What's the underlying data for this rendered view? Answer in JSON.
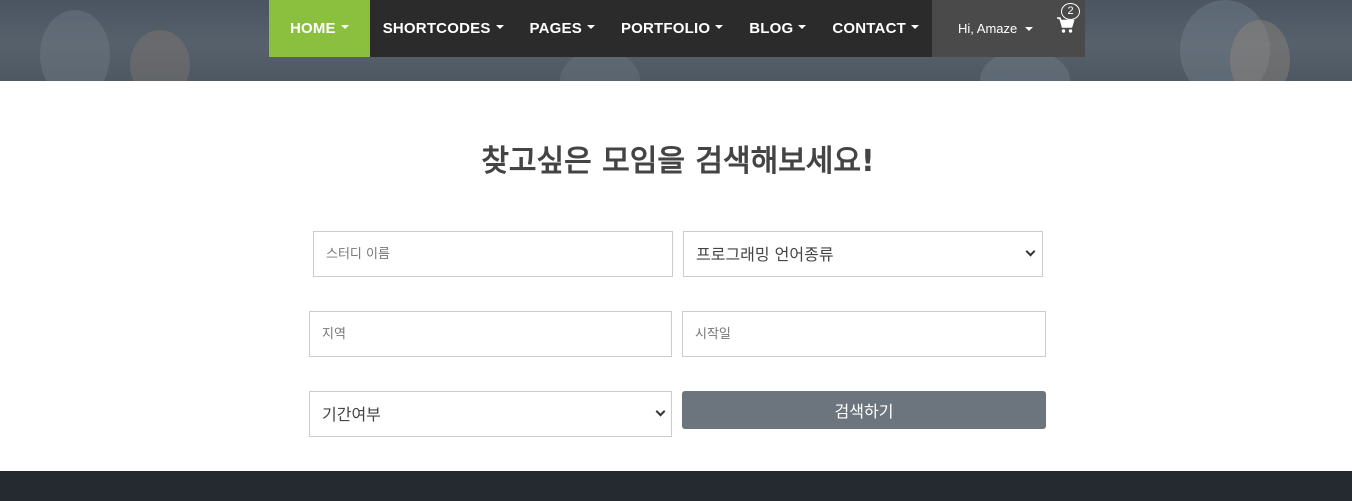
{
  "nav": {
    "items": [
      {
        "label": "HOME",
        "active": true
      },
      {
        "label": "SHORTCODES",
        "active": false
      },
      {
        "label": "PAGES",
        "active": false
      },
      {
        "label": "PORTFOLIO",
        "active": false
      },
      {
        "label": "BLOG",
        "active": false
      },
      {
        "label": "CONTACT",
        "active": false
      }
    ],
    "user_label": "Hi, Amaze",
    "cart_count": "2",
    "cart_icon": "shopping-cart-icon"
  },
  "colors": {
    "accent": "#8bc03f",
    "nav_bg": "#2b2b2b",
    "user_bg": "#4a4a4a",
    "button_bg": "#6c757d",
    "footer_bg": "#252a31"
  },
  "search": {
    "title": "찾고싶은 모임을 검색해보세요!",
    "study_name_placeholder": "스터디 이름",
    "language_select": "프로그래밍 언어종류",
    "region_placeholder": "지역",
    "start_date_placeholder": "시작일",
    "period_select": "기간여부",
    "submit_label": "검색하기"
  }
}
